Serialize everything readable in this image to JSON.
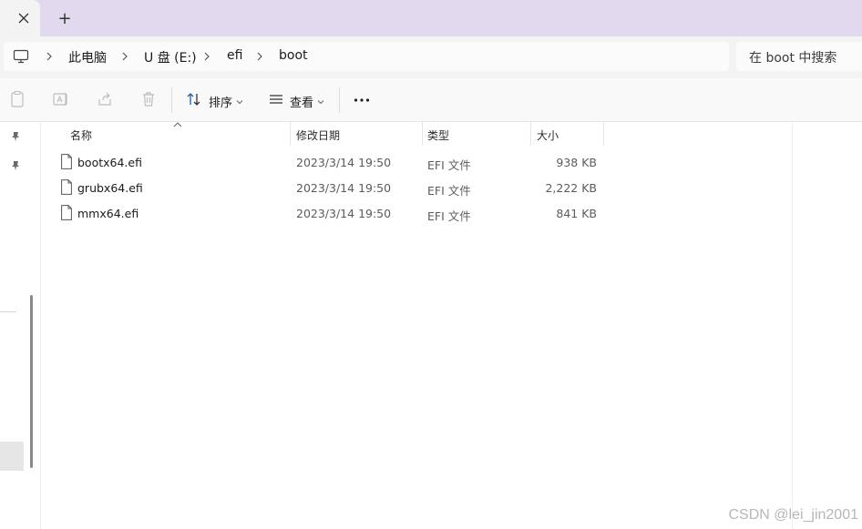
{
  "tabs": {
    "new_tab_label": "+"
  },
  "breadcrumb": {
    "items": [
      "此电脑",
      "U 盘 (E:)",
      "efi",
      "boot"
    ]
  },
  "search": {
    "placeholder": "在 boot 中搜索"
  },
  "toolbar": {
    "sort_label": "排序",
    "view_label": "查看",
    "more_label": "···",
    "icons": [
      "paste-icon",
      "rename-icon",
      "share-icon",
      "delete-icon",
      "sort-icon",
      "view-icon",
      "more-icon"
    ]
  },
  "columns": {
    "name": "名称",
    "date": "修改日期",
    "type": "类型",
    "size": "大小"
  },
  "files": [
    {
      "name": "bootx64.efi",
      "date": "2023/3/14 19:50",
      "type": "EFI 文件",
      "size": "938 KB"
    },
    {
      "name": "grubx64.efi",
      "date": "2023/3/14 19:50",
      "type": "EFI 文件",
      "size": "2,222 KB"
    },
    {
      "name": "mmx64.efi",
      "date": "2023/3/14 19:50",
      "type": "EFI 文件",
      "size": "841 KB"
    }
  ],
  "watermark": "CSDN @lei_jin2001",
  "colors": {
    "tabstrip": "#e2d9ef",
    "chrome": "#f3f3f3",
    "accent": "#0067c0"
  }
}
